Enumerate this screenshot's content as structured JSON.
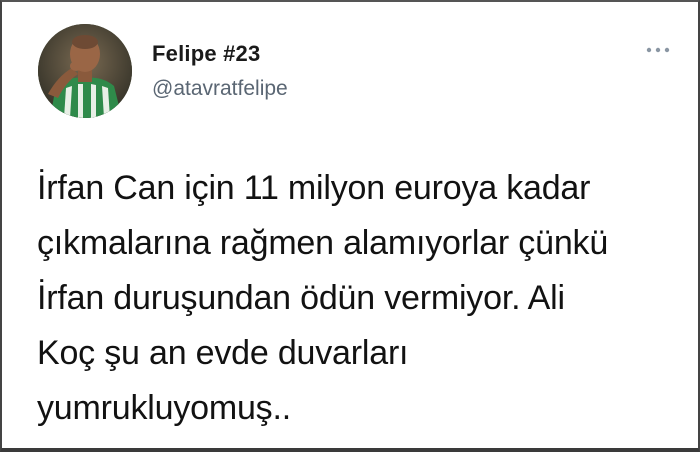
{
  "tweet": {
    "author": {
      "display_name": "Felipe #23",
      "handle": "@atavratfelipe",
      "avatar_icon": "profile-photo-icon"
    },
    "more_icon": "more-options-icon",
    "text": "İrfan Can için 11 milyon euroya kadar\nçıkmalarına rağmen alamıyorlar çünkü\nİrfan duruşundan ödün vermiyor. Ali\nKoç şu an evde duvarları\nyumrukluyomuş.."
  },
  "colors": {
    "background": "#ffffff",
    "name": "#1a1a1a",
    "handle": "#5a6673",
    "text": "#121212",
    "jersey_green": "#2f8a4a"
  }
}
